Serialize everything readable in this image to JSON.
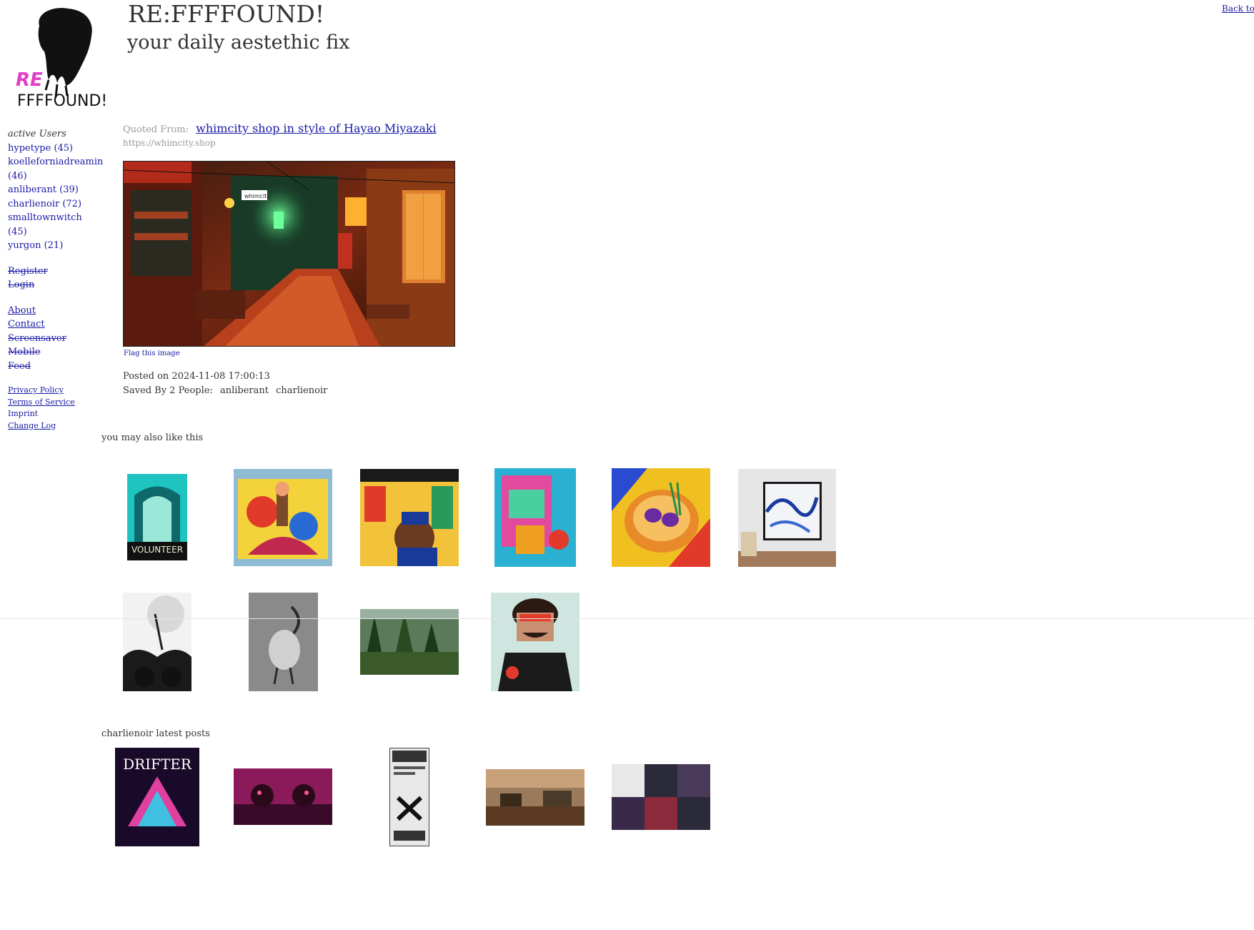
{
  "header": {
    "title": "RE:FFFFOUND!",
    "tagline": "your daily aestethic fix",
    "back_link": "Back to I",
    "logo_text_1": "RE",
    "logo_text_2": "FFFFOUND!"
  },
  "sidebar": {
    "active_title": "active Users",
    "users": [
      {
        "label": "hypetype (45)"
      },
      {
        "label": "koelleforniadreamin (46)"
      },
      {
        "label": "anliberant (39)"
      },
      {
        "label": "charlienoir (72)"
      },
      {
        "label": "smalltownwitch (45)"
      },
      {
        "label": "yurgon (21)"
      }
    ],
    "account": [
      "Register",
      "Login"
    ],
    "info": [
      "About",
      "Contact",
      "Screensaver",
      "Mobile",
      "Feed"
    ],
    "legal": [
      "Privacy Policy",
      "Terms of Service",
      "Imprint",
      "Change Log"
    ]
  },
  "post": {
    "quoted_label": "Quoted From:",
    "quoted_title": "whimcity shop in style of Hayao Miyazaki",
    "source_url": "https://whimcity.shop",
    "image_sign": "whimcity",
    "flag": "Flag this image",
    "posted": "Posted on 2024-11-08 17:00:13",
    "saved_label": "Saved By 2 People:",
    "saved_users": [
      "anliberant",
      "charlienoir"
    ]
  },
  "related": {
    "title": "you may also like this",
    "poster_text": "VOLUNTEER"
  },
  "latest": {
    "title": "charlienoir latest posts",
    "drifter_text": "DRIFTER"
  }
}
